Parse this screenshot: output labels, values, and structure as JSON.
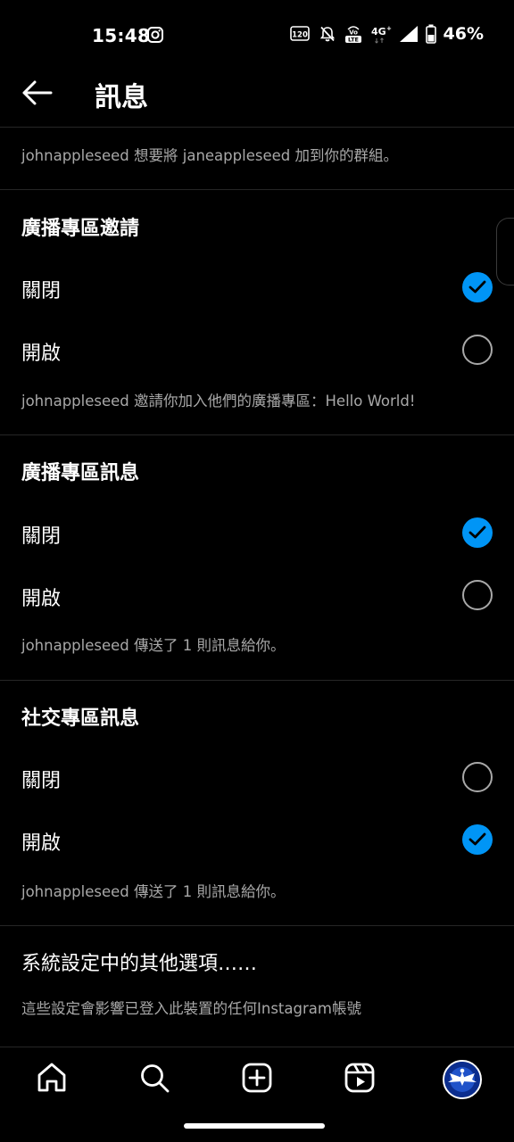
{
  "status_bar": {
    "time": "15:48",
    "battery": "46%",
    "network": "4G",
    "refresh_rate": "120",
    "volte": "Vo LTE"
  },
  "header": {
    "title": "訊息"
  },
  "intro_caption": "johnappleseed 想要將 janeappleseed 加到你的群組。",
  "sections": [
    {
      "title": "廣播專區邀請",
      "options": [
        {
          "label": "關閉",
          "selected": true
        },
        {
          "label": "開啟",
          "selected": false
        }
      ],
      "caption": "johnappleseed 邀請你加入他們的廣播專區：Hello World!"
    },
    {
      "title": "廣播專區訊息",
      "options": [
        {
          "label": "關閉",
          "selected": true
        },
        {
          "label": "開啟",
          "selected": false
        }
      ],
      "caption": "johnappleseed 傳送了 1 則訊息給你。"
    },
    {
      "title": "社交專區訊息",
      "options": [
        {
          "label": "關閉",
          "selected": false
        },
        {
          "label": "開啟",
          "selected": true
        }
      ],
      "caption": "johnappleseed 傳送了 1 則訊息給你。"
    }
  ],
  "other_options": {
    "title": "系統設定中的其他選項……",
    "caption": "這些設定會影響已登入此裝置的任何Instagram帳號"
  },
  "nav": {
    "icons": [
      "home-icon",
      "search-icon",
      "create-icon",
      "reels-icon",
      "profile-avatar"
    ]
  },
  "colors": {
    "accent": "#0095f6",
    "background": "#000000",
    "secondary_text": "#a8a8a8",
    "divider": "#262626"
  }
}
